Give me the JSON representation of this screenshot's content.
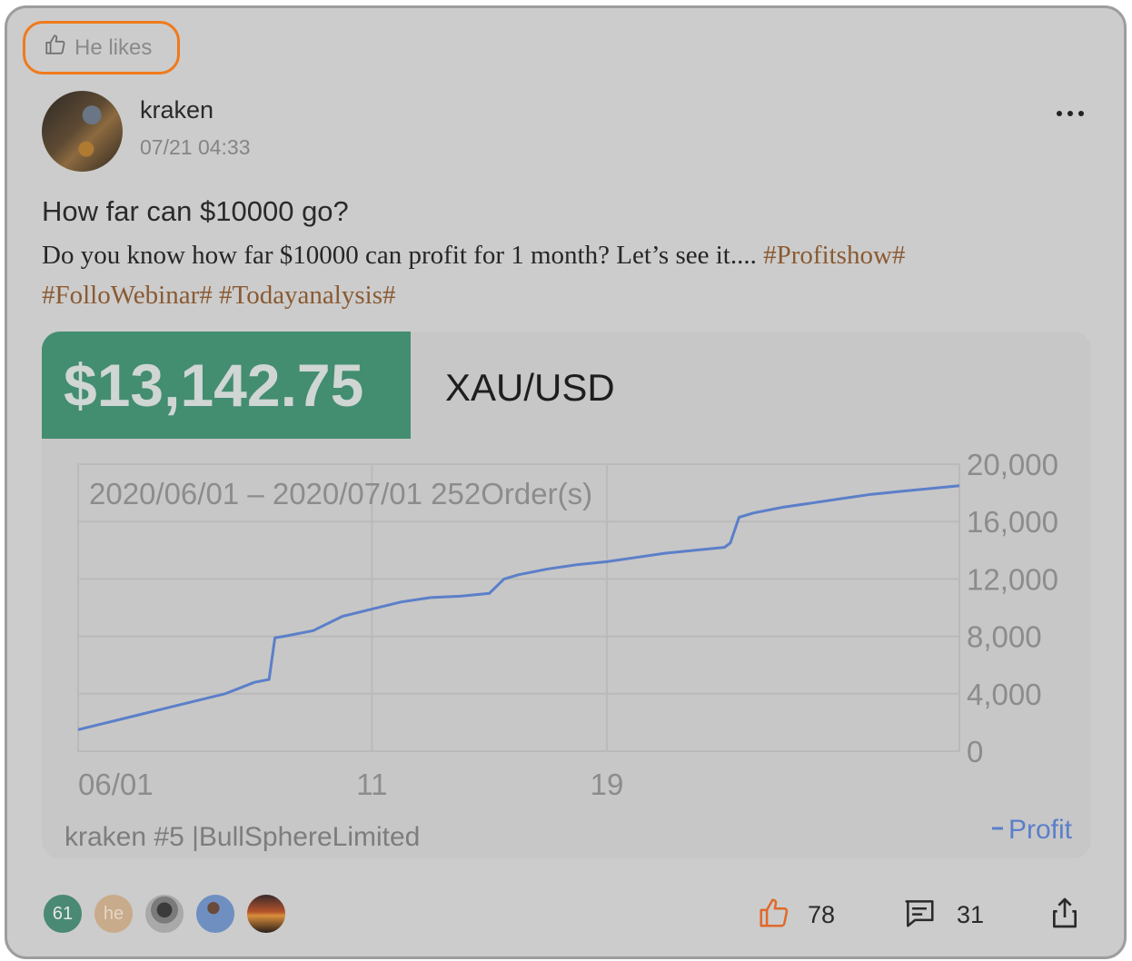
{
  "badge": {
    "label": "He likes",
    "icon": "thumbs-up-icon"
  },
  "post": {
    "author": "kraken",
    "timestamp": "07/21 04:33",
    "title": "How far can $10000 go?",
    "body": "Do you know how far $10000 can profit for 1 month? Let’s see it.... ",
    "hashtags": [
      "#Profitshow#",
      "#FolloWebinar#",
      "#Todayanalysis#"
    ]
  },
  "chart_card": {
    "profit": "$13,142.75",
    "pair": "XAU/USD",
    "date_range": "2020/06/01 – 2020/07/01 252Order(s)",
    "footer_left": "kraken #5 |BullSphereLimited",
    "legend": "Profit"
  },
  "chart_data": {
    "type": "line",
    "title": "",
    "xlabel": "",
    "ylabel": "",
    "x_tick_labels": [
      "06/01",
      "11",
      "19"
    ],
    "x_ticks_at_day": [
      1,
      11,
      19
    ],
    "y_tick_labels": [
      "0",
      "4,000",
      "8,000",
      "12,000",
      "16,000",
      "20,000"
    ],
    "ylim": [
      0,
      20000
    ],
    "xlim_day": [
      1,
      31
    ],
    "y_axis_position": "right",
    "grid": true,
    "legend_position": "bottom-right",
    "series": [
      {
        "name": "Profit",
        "color": "#5b7fc9",
        "x_day": [
          1,
          2,
          3,
          4,
          5,
          6,
          7,
          7.5,
          7.7,
          8,
          9,
          10,
          11,
          12,
          13,
          14,
          15,
          15.5,
          16,
          17,
          18,
          19,
          20,
          21,
          22,
          23,
          23.2,
          23.5,
          24,
          25,
          26,
          27,
          28,
          29,
          30,
          31
        ],
        "values": [
          1500,
          2000,
          2500,
          3000,
          3500,
          4000,
          4800,
          5000,
          7900,
          8000,
          8400,
          9400,
          9900,
          10400,
          10700,
          10800,
          11000,
          12000,
          12300,
          12700,
          13000,
          13200,
          13500,
          13800,
          14000,
          14200,
          14500,
          16300,
          16600,
          17000,
          17300,
          17600,
          17900,
          18100,
          18300,
          18500
        ]
      }
    ]
  },
  "footer": {
    "avatars": [
      "61",
      "he"
    ],
    "likes": "78",
    "comments": "31"
  },
  "colors": {
    "accent_orange": "#f07a1c",
    "profit_green": "#438d71",
    "hashtag_brown": "#8a5a32",
    "line_blue": "#5b7fc9"
  }
}
